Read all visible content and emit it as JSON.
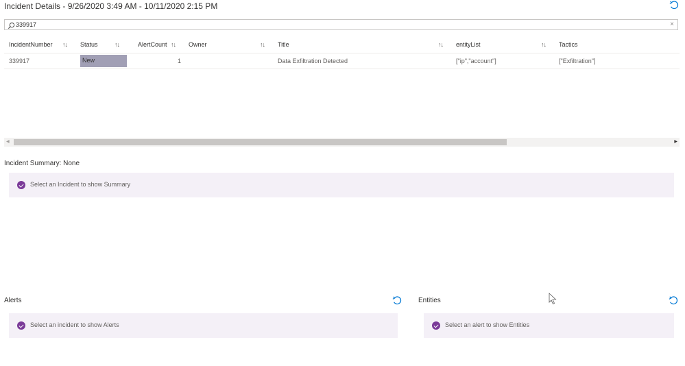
{
  "header": {
    "title": "Incident Details - 9/26/2020 3:49 AM - 10/11/2020 2:15 PM"
  },
  "search": {
    "value": "339917",
    "clear_label": "×"
  },
  "table": {
    "sort_glyph": "↑↓",
    "columns": [
      "IncidentNumber",
      "Status",
      "AlertCount",
      "Owner",
      "Title",
      "entityList",
      "Tactics"
    ],
    "rows": [
      {
        "IncidentNumber": "339917",
        "Status": "New",
        "AlertCount": "1",
        "Owner": "",
        "Title": "Data Exfiltration Detected",
        "entityList": "[\"ip\",\"account\"]",
        "Tactics": "[\"Exfiltration\"]"
      }
    ],
    "status_color": "#a19fb5"
  },
  "summary": {
    "title": "Incident Summary: None",
    "message": "Select an Incident to show Summary"
  },
  "alerts": {
    "title": "Alerts",
    "message": "Select an incident to show Alerts"
  },
  "entities": {
    "title": "Entities",
    "message": "Select an alert to show Entities"
  },
  "colors": {
    "accent": "#0078d4",
    "info_bg": "#f4f0f7",
    "info_icon": "#7a3a98"
  }
}
